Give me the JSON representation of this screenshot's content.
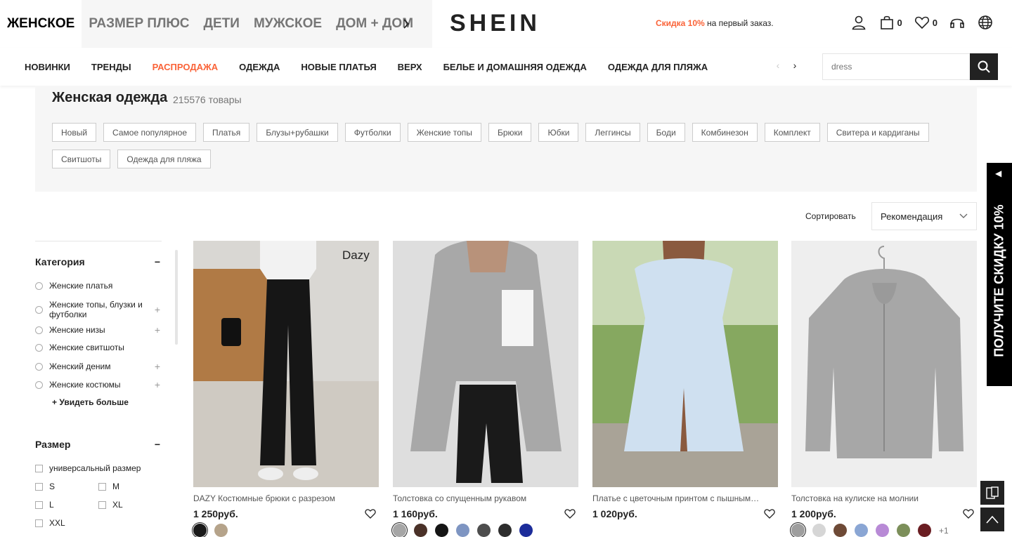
{
  "header": {
    "channels": [
      "ЖЕНСКОЕ",
      "РАЗМЕР ПЛЮС",
      "ДЕТИ",
      "МУЖСКОЕ",
      "ДОМ + ДОМ"
    ],
    "logo": "SHEIN",
    "promo_highlight": "Скидка 10%",
    "promo_text": " на первый заказ.",
    "bag_count": "0",
    "wish_count": "0",
    "icons": [
      "chevron-right-icon",
      "user-icon",
      "bag-icon",
      "heart-icon",
      "headset-icon",
      "globe-icon"
    ]
  },
  "nav": {
    "items": [
      "НОВИНКИ",
      "ТРЕНДЫ",
      "РАСПРОДАЖА",
      "ОДЕЖДА",
      "НОВЫЕ ПЛАТЬЯ",
      "ВЕРХ",
      "БЕЛЬЕ И ДОМАШНЯЯ ОДЕЖДА",
      "ОДЕЖДА ДЛЯ ПЛЯЖА"
    ],
    "sale_color": "#fa6338",
    "search_placeholder": "dress"
  },
  "category": {
    "title": "Женская одежда",
    "count": "215576 товары",
    "chips": [
      "Новый",
      "Самое популярное",
      "Платья",
      "Блузы+рубашки",
      "Футболки",
      "Женские топы",
      "Брюки",
      "Юбки",
      "Леггинсы",
      "Боди",
      "Комбинезон",
      "Комплект",
      "Свитера и кардиганы",
      "Свитшоты",
      "Одежда для пляжа"
    ]
  },
  "sort": {
    "label": "Сортировать",
    "value": "Рекомендация"
  },
  "sidebar": {
    "category_title": "Категория",
    "category_items": [
      {
        "label": "Женские платья",
        "expandable": false
      },
      {
        "label": "Женские топы, блузки и футболки",
        "expandable": true
      },
      {
        "label": "Женские низы",
        "expandable": true
      },
      {
        "label": "Женские свитшоты",
        "expandable": false
      },
      {
        "label": "Женский деним",
        "expandable": true
      },
      {
        "label": "Женские костюмы",
        "expandable": true
      }
    ],
    "see_more": "+ Увидеть больше",
    "size_title": "Размер",
    "sizes": [
      "универсальный размер",
      "S",
      "M",
      "L",
      "XL",
      "XXL"
    ]
  },
  "products": [
    {
      "name": "DAZY Костюмные брюки с разрезом",
      "price": "1 250руб.",
      "brand_tag": "Dazy",
      "swatches": [
        "#1a1a1a",
        "#b5a38a"
      ]
    },
    {
      "name": "Толстовка со спущенным рукавом",
      "price": "1 160руб.",
      "swatches": [
        "#a6a6a6",
        "#4a3128",
        "#151515",
        "#7e95c2",
        "#4d4d4d",
        "#2d2d2d",
        "#1c2c9a"
      ]
    },
    {
      "name": "Платье с цветочным принтом с пышным рукавом",
      "price": "1 020руб."
    },
    {
      "name": "Толстовка на кулиске на молнии",
      "price": "1 200руб.",
      "swatches": [
        "#9e9e9e",
        "#d6d6d6",
        "#6e4a36",
        "#8aa6d4",
        "#b88ad6",
        "#7c8f5a",
        "#6a1d22"
      ],
      "more": "+1"
    }
  ],
  "right": {
    "promo_tab": "ПОЛУЧИТЕ СКИДКУ 10%"
  }
}
